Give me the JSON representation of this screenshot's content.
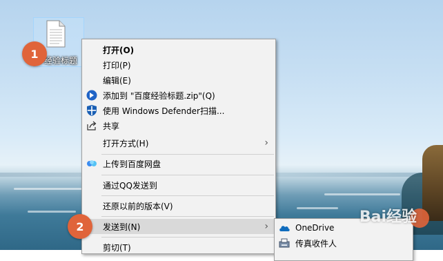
{
  "desktop": {
    "file_label": "经验标题"
  },
  "context_menu": {
    "items": [
      {
        "label": "打开(O)",
        "bold": true,
        "icon": ""
      },
      {
        "label": "打印(P)",
        "icon": ""
      },
      {
        "label": "编辑(E)",
        "icon": ""
      },
      {
        "label": "添加到 \"百度经验标题.zip\"(Q)",
        "icon": "archive-icon"
      },
      {
        "label": "使用 Windows Defender扫描...",
        "icon": "shield-icon"
      },
      {
        "label": "共享",
        "icon": "share-icon"
      },
      {
        "label": "打开方式(H)",
        "icon": "",
        "submenu": true
      },
      {
        "label": "上传到百度网盘",
        "icon": "baidu-netdisk-icon"
      },
      {
        "label": "通过QQ发送到",
        "icon": ""
      },
      {
        "label": "还原以前的版本(V)",
        "icon": ""
      },
      {
        "label": "发送到(N)",
        "icon": "",
        "submenu": true,
        "highlighted": true
      },
      {
        "label": "剪切(T)",
        "icon": ""
      }
    ],
    "arrow_glyph": "›"
  },
  "send_to_submenu": {
    "items": [
      {
        "label": "OneDrive",
        "icon": "onedrive-icon"
      },
      {
        "label": "传真收件人",
        "icon": "fax-icon"
      }
    ]
  },
  "annotations": {
    "step1": "1",
    "step2": "2"
  },
  "watermark": {
    "text": "Bai经验"
  },
  "colors": {
    "menu_bg": "#f2f2f2",
    "highlight": "#d9d9d9",
    "badge": "#e0643a",
    "onedrive": "#0f6cbd"
  }
}
